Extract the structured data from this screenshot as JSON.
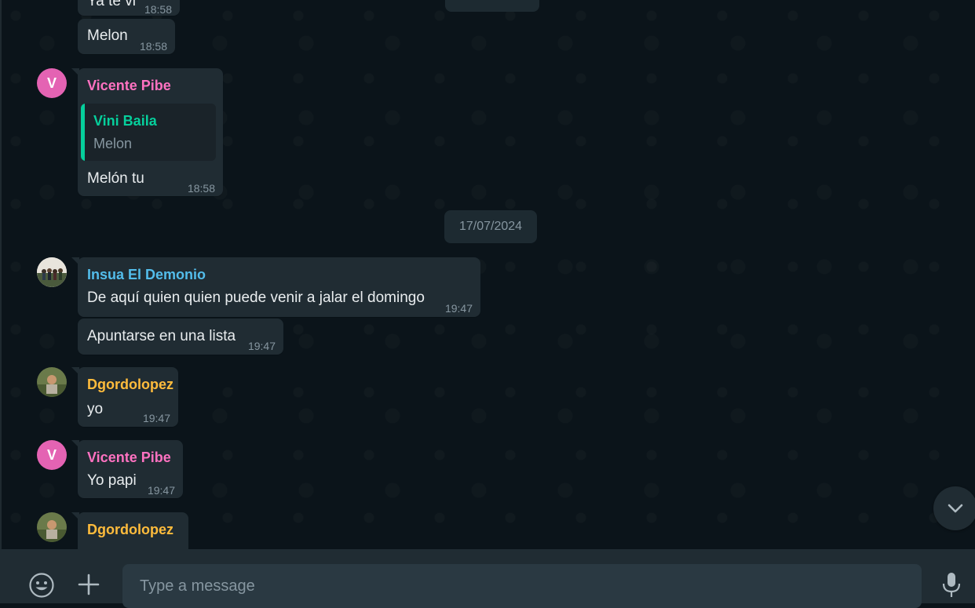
{
  "messages_top": {
    "partial_text": "Ya te vi",
    "partial_time": "18:58",
    "melon_text": "Melon",
    "melon_time": "18:58"
  },
  "msg_vicente_reply": {
    "sender": "Vicente Pibe",
    "sender_color": "#ff72c1",
    "quote_sender": "Vini Baila",
    "quote_text": "Melon",
    "text": "Melón tu",
    "time": "18:58",
    "avatar_letter": "V"
  },
  "date_divider": "17/07/2024",
  "msg_insua": {
    "sender": "Insua El Demonio",
    "sender_color": "#53bdeb",
    "text": "De aquí quien quien puede venir a jalar el domingo",
    "time": "19:47",
    "followup_text": "Apuntarse en una lista",
    "followup_time": "19:47"
  },
  "msg_dgordo_1": {
    "sender": "Dgordolopez",
    "sender_color": "#ffbc3c",
    "text": "yo",
    "time": "19:47"
  },
  "msg_vicente_2": {
    "sender": "Vicente Pibe",
    "text": "Yo papi",
    "time": "19:47",
    "avatar_letter": "V"
  },
  "msg_dgordo_2": {
    "sender": "Dgordolopez"
  },
  "composer": {
    "placeholder": "Type a message"
  },
  "icons": {
    "emoji": "emoji-icon",
    "attach": "plus-icon",
    "mic": "mic-icon",
    "scroll": "chevron-down-icon"
  }
}
